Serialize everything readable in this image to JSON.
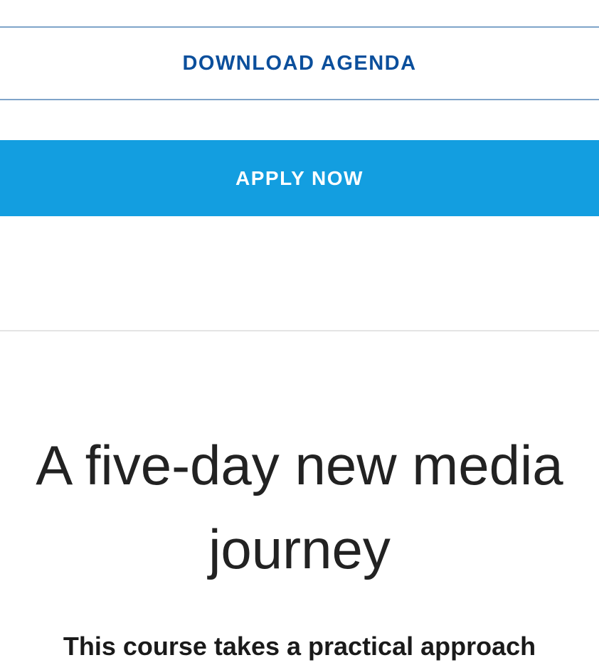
{
  "actions": {
    "download_label": "DOWNLOAD AGENDA",
    "apply_label": "APPLY NOW"
  },
  "course": {
    "headline": "A five-day new media journey",
    "intro": "This course takes a practical approach"
  },
  "colors": {
    "download_text": "#0b4f9c",
    "download_border": "#7fa4c9",
    "apply_background": "#139ee0",
    "apply_text": "#ffffff",
    "divider": "#e4e4e4",
    "headline_text": "#222222"
  }
}
